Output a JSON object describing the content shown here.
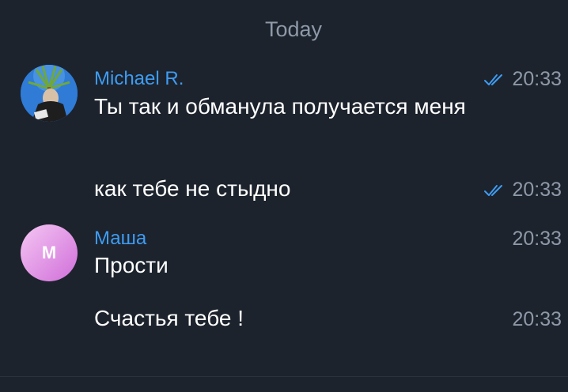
{
  "date_separator": "Today",
  "messages": [
    {
      "sender": "Michael R.",
      "avatar": "photo",
      "text": "Ты так и обманула получается меня",
      "time": "20:33",
      "status": "read-double-check"
    },
    {
      "text": "как тебе не стыдно",
      "time": "20:33",
      "status": "read-double-check"
    },
    {
      "sender": "Маша",
      "avatar_initial": "M",
      "text": "Прости",
      "time": "20:33"
    },
    {
      "text": "Счастья тебе !",
      "time": "20:33"
    }
  ],
  "colors": {
    "background": "#1c232d",
    "sender_name": "#3e9cf2",
    "timestamp": "#8e99a8",
    "check": "#3e9cf2",
    "avatar_gradient_start": "#f5c6f3",
    "avatar_gradient_end": "#d06fd9"
  }
}
